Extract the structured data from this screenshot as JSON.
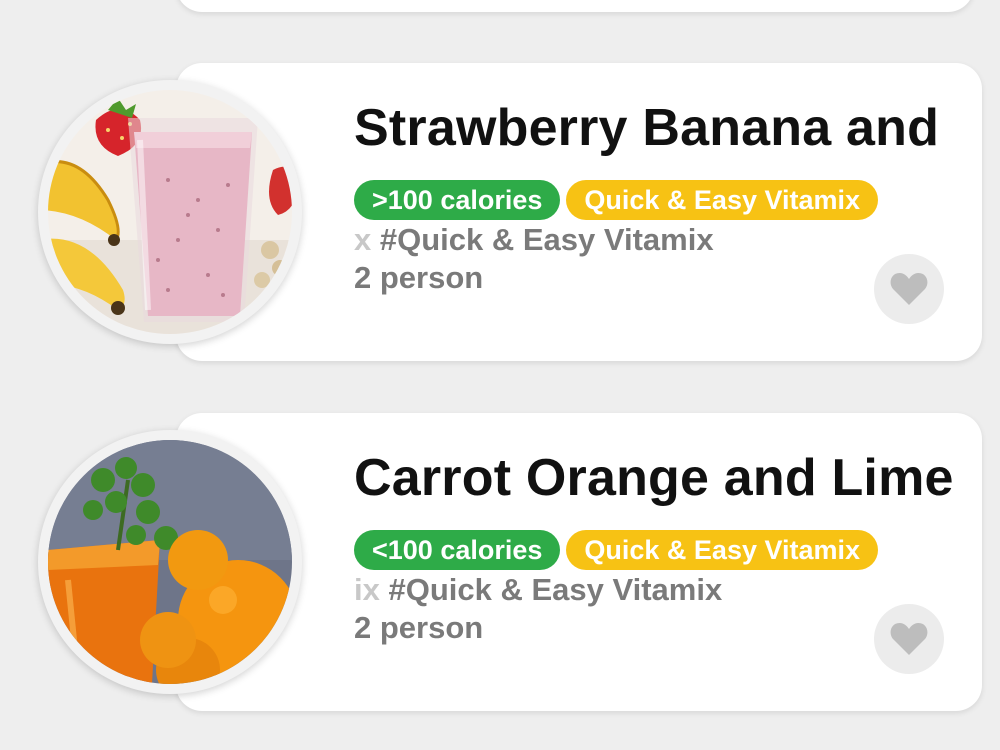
{
  "recipes": [
    {
      "title": "Strawberry Banana and",
      "tags": [
        ">100 calories",
        "Quick & Easy Vitamix"
      ],
      "hashtag_prefix": "x",
      "hashtag": "#Quick & Easy Vitamix",
      "serves": "2 person",
      "image": "strawberry-banana-smoothie"
    },
    {
      "title": "Carrot Orange and Lime",
      "tags": [
        "<100 calories",
        "Quick & Easy Vitamix"
      ],
      "hashtag_prefix": "ix",
      "hashtag": "#Quick & Easy Vitamix",
      "serves": "2 person",
      "image": "carrot-orange-juice"
    }
  ],
  "icons": {
    "favorite": "heart-icon"
  },
  "colors": {
    "background": "#eeeeee",
    "card": "#ffffff",
    "calorie_tag": "#2eab48",
    "category_tag": "#f7c214",
    "secondary_text": "#7a7a7a",
    "heart": "#bdbdbd"
  }
}
